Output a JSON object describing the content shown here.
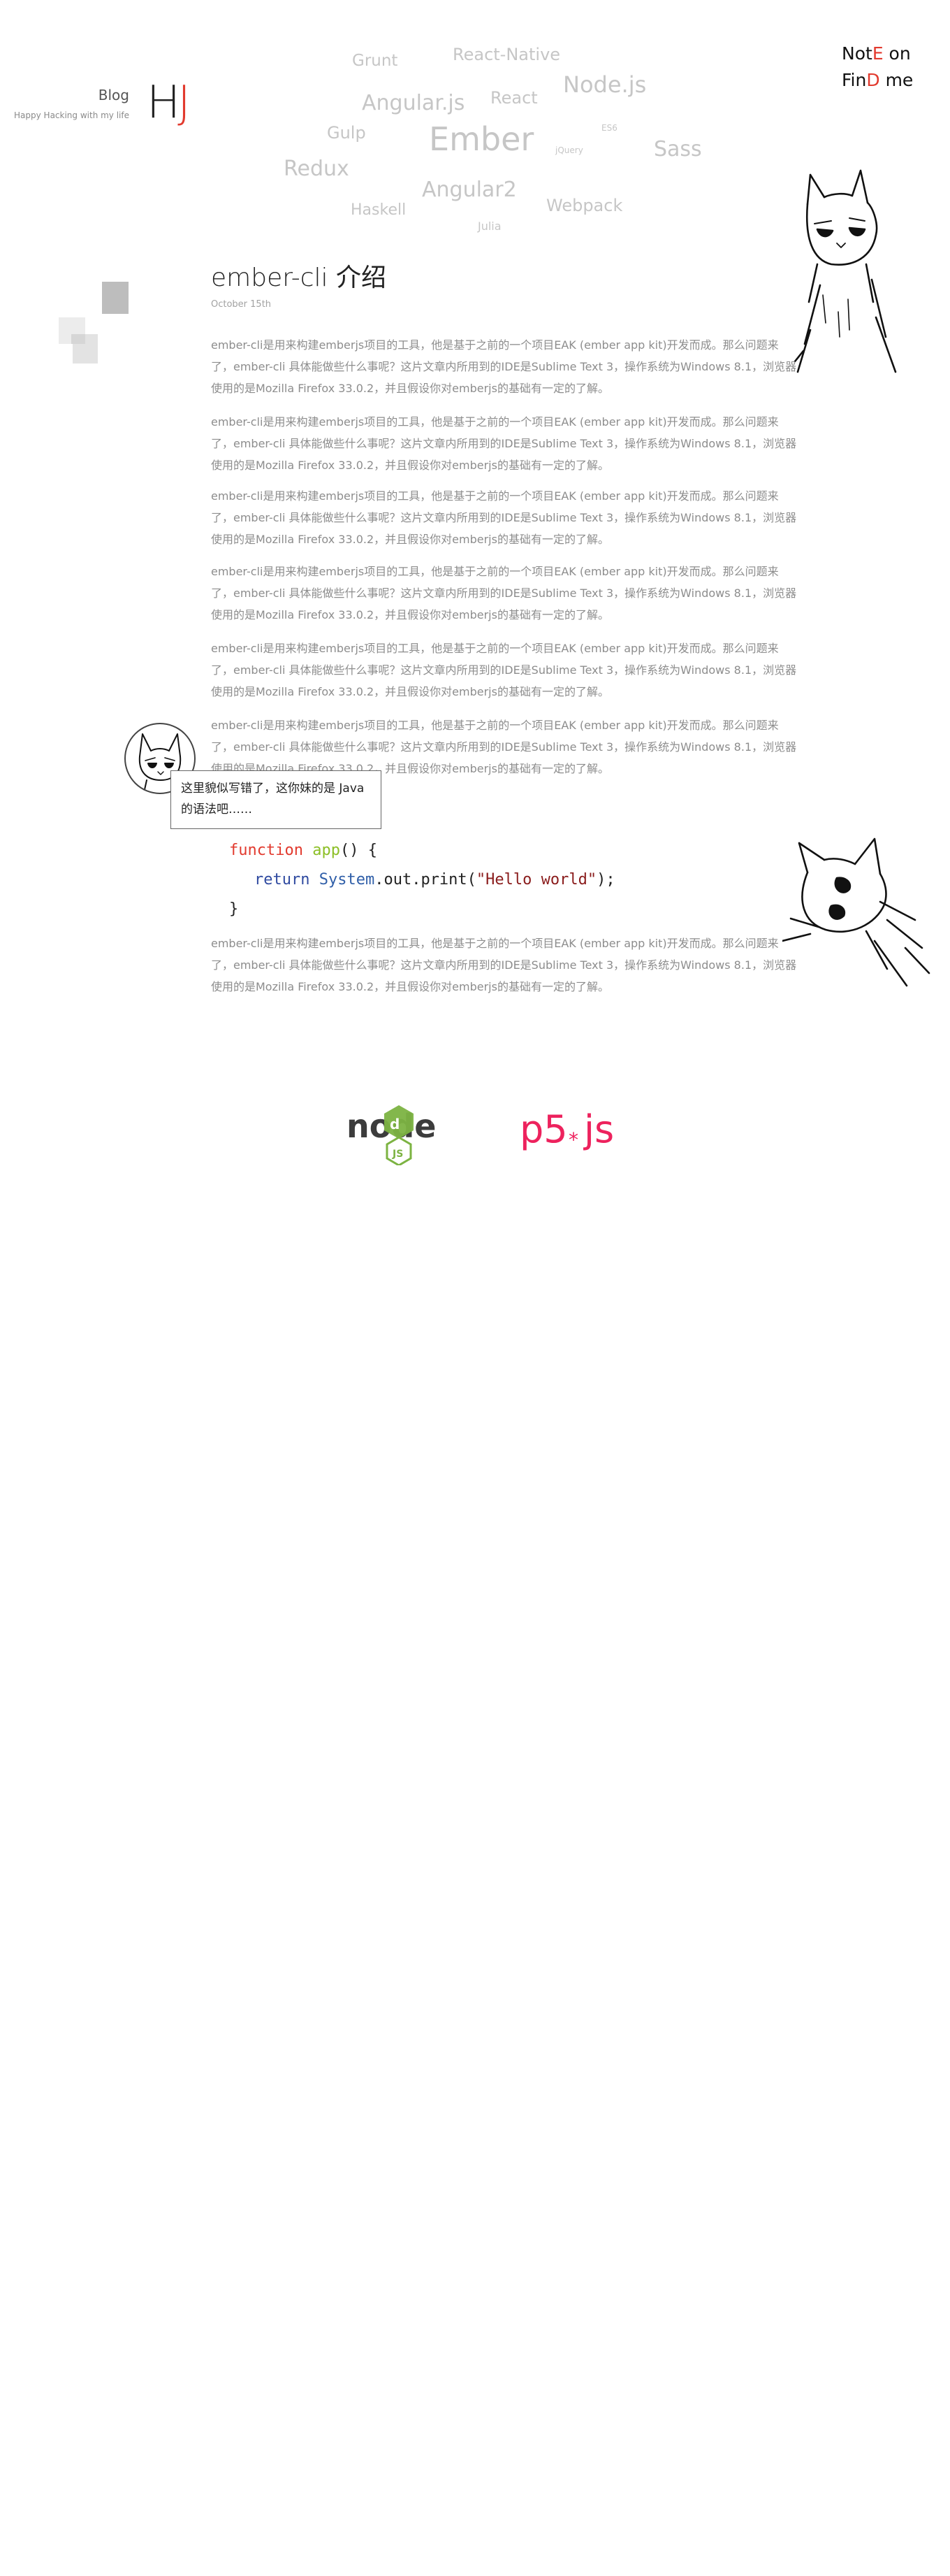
{
  "brand": {
    "blog_label": "Blog",
    "tagline": "Happy Hacking with my life",
    "logo_h": "H",
    "logo_j": "J"
  },
  "nav": {
    "note_a": "Not",
    "note_b": "E",
    "note_c": " on",
    "find_a": "Fin",
    "find_b": "D",
    "find_c": " me"
  },
  "tag_cloud": [
    "Grunt",
    "React-Native",
    "Angular.js",
    "React",
    "Node.js",
    "Gulp",
    "Ember",
    "ES6",
    "jQuery",
    "Sass",
    "Redux",
    "Angular2",
    "Haskell",
    "Webpack",
    "Julia"
  ],
  "article": {
    "title": "ember-cli 介绍",
    "date": "October 15th",
    "paragraphs": [
      "ember-cli是用来构建emberjs项目的工具，他是基于之前的一个项目EAK (ember app kit)开发而成。那么问题来了，ember-cli 具体能做些什么事呢？这片文章内所用到的IDE是Sublime Text 3，操作系统为Windows 8.1，浏览器使用的是Mozilla Firefox 33.0.2，并且假设你对emberjs的基础有一定的了解。",
      "ember-cli是用来构建emberjs项目的工具，他是基于之前的一个项目EAK (ember app kit)开发而成。那么问题来了，ember-cli 具体能做些什么事呢？这片文章内所用到的IDE是Sublime Text 3，操作系统为Windows 8.1，浏览器使用的是Mozilla Firefox 33.0.2，并且假设你对emberjs的基础有一定的了解。",
      "ember-cli是用来构建emberjs项目的工具，他是基于之前的一个项目EAK (ember app kit)开发而成。那么问题来了，ember-cli 具体能做些什么事呢？这片文章内所用到的IDE是Sublime Text 3，操作系统为Windows 8.1，浏览器使用的是Mozilla Firefox 33.0.2，并且假设你对emberjs的基础有一定的了解。",
      "ember-cli是用来构建emberjs项目的工具，他是基于之前的一个项目EAK (ember app kit)开发而成。那么问题来了，ember-cli 具体能做些什么事呢？这片文章内所用到的IDE是Sublime Text 3，操作系统为Windows 8.1，浏览器使用的是Mozilla Firefox 33.0.2，并且假设你对emberjs的基础有一定的了解。",
      "ember-cli是用来构建emberjs项目的工具，他是基于之前的一个项目EAK (ember app kit)开发而成。那么问题来了，ember-cli 具体能做些什么事呢？这片文章内所用到的IDE是Sublime Text 3，操作系统为Windows 8.1，浏览器使用的是Mozilla Firefox 33.0.2，并且假设你对emberjs的基础有一定的了解。",
      "ember-cli是用来构建emberjs项目的工具，他是基于之前的一个项目EAK (ember app kit)开发而成。那么问题来了，ember-cli 具体能做些什么事呢？这片文章内所用到的IDE是Sublime Text 3，操作系统为Windows 8.1，浏览器使用的是Mozilla Firefox 33.0.2，并且假设你对emberjs的基础有一定的了解。",
      "ember-cli是用来构建emberjs项目的工具，他是基于之前的一个项目EAK (ember app kit)开发而成。那么问题来了，ember-cli 具体能做些什么事呢？这片文章内所用到的IDE是Sublime Text 3，操作系统为Windows 8.1，浏览器使用的是Mozilla Firefox 33.0.2，并且假设你对emberjs的基础有一定的了解。"
    ]
  },
  "bubble": {
    "text": "这里貌似写错了，这你妹的是 Java 的语法吧……"
  },
  "code": {
    "kw_function": "function",
    "fn_name": "app",
    "sig_rest": "() {",
    "kw_return": "return",
    "cls": "System",
    "chain": ".out.print(",
    "str": "\"Hello world\"",
    "tail": ");",
    "close": "}"
  },
  "logos": {
    "node_text": "node",
    "node_badge": "JS",
    "p5_text": "p5",
    "p5_js": "js",
    "p5_star": "*",
    "colors": {
      "node": "#3c3c3c",
      "node_green": "#7cb342",
      "p5": "#ed225d"
    }
  },
  "colors": {
    "accent": "#e23a2e",
    "cloud": "#c6c6c6",
    "body_text": "#8d8d8d"
  },
  "icons": [
    "cat-doodle-icon",
    "cat-avatar-icon",
    "nodejs-logo-icon",
    "p5js-logo-icon"
  ]
}
